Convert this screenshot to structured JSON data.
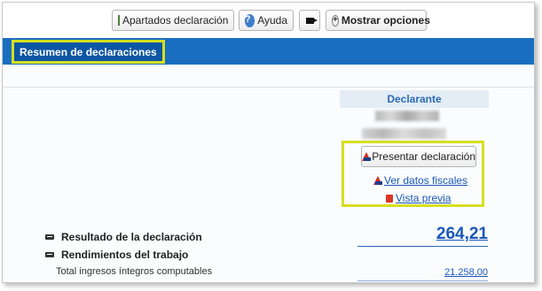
{
  "toolbar": {
    "apartados_label": "Apartados declaración",
    "ayuda_label": "Ayuda",
    "mostrar_label": "Mostrar opciones",
    "icons": [
      "form-icon",
      "help-icon",
      "video-icon",
      "plus-icon"
    ]
  },
  "header": {
    "tab_label": "Resumen de declaraciones",
    "bar_color": "#1a6ec1",
    "highlight_color": "#d6df1f"
  },
  "declarante": {
    "header": "Declarante",
    "present_label": "Presentar declaración",
    "datos_fiscales_link": "Ver datos fiscales",
    "vista_previa_link": "Vista previa"
  },
  "summary": {
    "resultado_label": "Resultado de la declaración",
    "resultado_value": "264,21",
    "rendimientos_label": "Rendimientos del trabajo",
    "ingresos_label": "Total ingresos íntegros computables",
    "ingresos_value": "21.258,00"
  }
}
